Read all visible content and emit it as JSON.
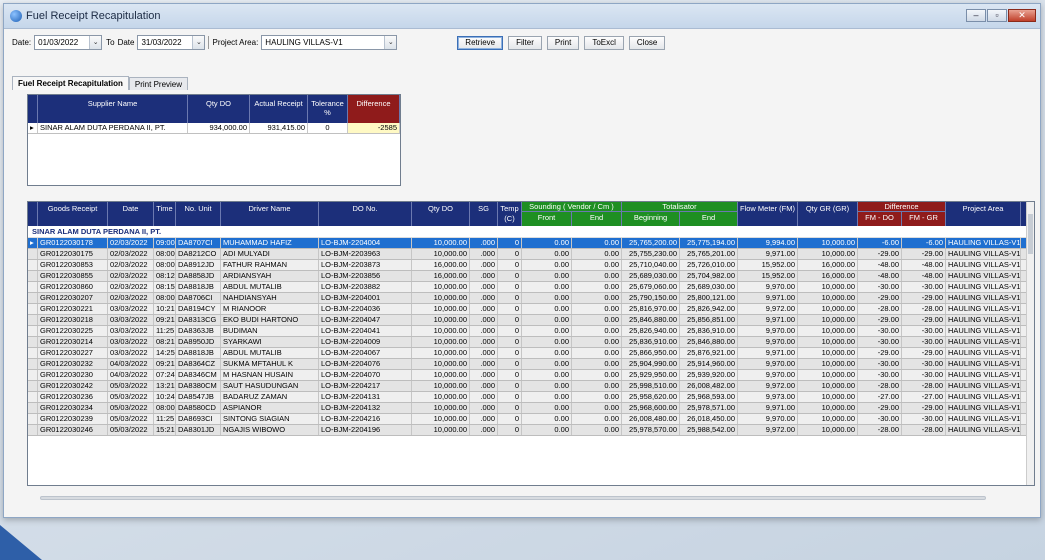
{
  "window": {
    "title": "Fuel Receipt Recapitulation"
  },
  "toolbar": {
    "date_label": "Date:",
    "date_from": "01/03/2022",
    "to_label": "To",
    "date_label2": "Date",
    "date_to": "31/03/2022",
    "project_label": "Project Area:",
    "project_value": "HAULING VILLAS-V1",
    "buttons": [
      "Retrieve",
      "Filter",
      "Print",
      "ToExcl",
      "Close"
    ]
  },
  "tabs": [
    "Fuel Receipt Recapitulation",
    "Print Preview"
  ],
  "summary": {
    "headers": [
      "Supplier Name",
      "Qty DO",
      "Actual Receipt",
      "Tolerance %",
      "Difference"
    ],
    "rows": [
      [
        "SINAR ALAM DUTA PERDANA II, PT.",
        "934,000.00",
        "931,415.00",
        "0",
        "-2585"
      ]
    ]
  },
  "detail": {
    "headers": {
      "goods_receipt": "Goods Receipt",
      "date": "Date",
      "time": "Time",
      "no_unit": "No. Unit",
      "driver": "Driver Name",
      "do_no": "DO No.",
      "qty_do": "Qty DO",
      "sg": "SG",
      "temp": "Temp (C)",
      "sounding": "Sounding ( Vendor / Cm )",
      "sounding_front": "Front",
      "sounding_end": "End",
      "totalisator": "Totalisator",
      "tot_begin": "Beginning",
      "tot_end": "End",
      "flow_meter": "Flow Meter (FM)",
      "qty_gr": "Qty GR (GR)",
      "difference": "Difference",
      "fm_do": "FM - DO",
      "fm_gr": "FM - GR",
      "project_area": "Project Area"
    },
    "group": "SINAR ALAM DUTA PERDANA II, PT.",
    "rows": [
      [
        "GR0122030178",
        "02/03/2022",
        "09:00",
        "DA8707CI",
        "MUHAMMAD HAFIZ",
        "LO-BJM-2204004",
        "10,000.00",
        ".000",
        "0",
        "0.00",
        "0.00",
        "25,765,200.00",
        "25,775,194.00",
        "9,994.00",
        "10,000.00",
        "-6.00",
        "-6.00",
        "HAULING VILLAS-V1"
      ],
      [
        "GR0122030175",
        "02/03/2022",
        "08:00",
        "DA8212CO",
        "ADI MULYADI",
        "LO-BJM-2203963",
        "10,000.00",
        ".000",
        "0",
        "0.00",
        "0.00",
        "25,755,230.00",
        "25,765,201.00",
        "9,971.00",
        "10,000.00",
        "-29.00",
        "-29.00",
        "HAULING VILLAS-V1"
      ],
      [
        "GR0122030853",
        "02/03/2022",
        "08:00",
        "DA8912JD",
        "FATHUR RAHMAN",
        "LO-BJM-2203873",
        "16,000.00",
        ".000",
        "0",
        "0.00",
        "0.00",
        "25,710,040.00",
        "25,726,010.00",
        "15,952.00",
        "16,000.00",
        "-48.00",
        "-48.00",
        "HAULING VILLAS-V1"
      ],
      [
        "GR0122030855",
        "02/03/2022",
        "08:12",
        "DA8858JD",
        "ARDIANSYAH",
        "LO-BJM-2203856",
        "16,000.00",
        ".000",
        "0",
        "0.00",
        "0.00",
        "25,689,030.00",
        "25,704,982.00",
        "15,952.00",
        "16,000.00",
        "-48.00",
        "-48.00",
        "HAULING VILLAS-V1"
      ],
      [
        "GR0122030860",
        "02/03/2022",
        "08:15",
        "DA8818JB",
        "ABDUL MUTALIB",
        "LO-BJM-2203882",
        "10,000.00",
        ".000",
        "0",
        "0.00",
        "0.00",
        "25,679,060.00",
        "25,689,030.00",
        "9,970.00",
        "10,000.00",
        "-30.00",
        "-30.00",
        "HAULING VILLAS-V1"
      ],
      [
        "GR0122030207",
        "02/03/2022",
        "08:00",
        "DA8706CI",
        "NAHDIANSYAH",
        "LO-BJM-2204001",
        "10,000.00",
        ".000",
        "0",
        "0.00",
        "0.00",
        "25,790,150.00",
        "25,800,121.00",
        "9,971.00",
        "10,000.00",
        "-29.00",
        "-29.00",
        "HAULING VILLAS-V1"
      ],
      [
        "GR0122030221",
        "03/03/2022",
        "10:21",
        "DA8194CY",
        "M RIANOOR",
        "LO-BJM-2204036",
        "10,000.00",
        ".000",
        "0",
        "0.00",
        "0.00",
        "25,816,970.00",
        "25,826,942.00",
        "9,972.00",
        "10,000.00",
        "-28.00",
        "-28.00",
        "HAULING VILLAS-V1"
      ],
      [
        "GR0122030218",
        "03/03/2022",
        "09:21",
        "DA8313CG",
        "EKO BUDI HARTONO",
        "LO-BJM-2204047",
        "10,000.00",
        ".000",
        "0",
        "0.00",
        "0.00",
        "25,846,880.00",
        "25,856,851.00",
        "9,971.00",
        "10,000.00",
        "-29.00",
        "-29.00",
        "HAULING VILLAS-V1"
      ],
      [
        "GR0122030225",
        "03/03/2022",
        "11:25",
        "DA8363JB",
        "BUDIMAN",
        "LO-BJM-2204041",
        "10,000.00",
        ".000",
        "0",
        "0.00",
        "0.00",
        "25,826,940.00",
        "25,836,910.00",
        "9,970.00",
        "10,000.00",
        "-30.00",
        "-30.00",
        "HAULING VILLAS-V1"
      ],
      [
        "GR0122030214",
        "03/03/2022",
        "08:21",
        "DA8950JD",
        "SYARKAWI",
        "LO-BJM-2204009",
        "10,000.00",
        ".000",
        "0",
        "0.00",
        "0.00",
        "25,836,910.00",
        "25,846,880.00",
        "9,970.00",
        "10,000.00",
        "-30.00",
        "-30.00",
        "HAULING VILLAS-V1"
      ],
      [
        "GR0122030227",
        "03/03/2022",
        "14:25",
        "DA8818JB",
        "ABDUL MUTALIB",
        "LO-BJM-2204067",
        "10,000.00",
        ".000",
        "0",
        "0.00",
        "0.00",
        "25,866,950.00",
        "25,876,921.00",
        "9,971.00",
        "10,000.00",
        "-29.00",
        "-29.00",
        "HAULING VILLAS-V1"
      ],
      [
        "GR0122030232",
        "04/03/2022",
        "09:21",
        "DA8364CZ",
        "SUKMA MFTAHUL K",
        "LO-BJM-2204076",
        "10,000.00",
        ".000",
        "0",
        "0.00",
        "0.00",
        "25,904,990.00",
        "25,914,960.00",
        "9,970.00",
        "10,000.00",
        "-30.00",
        "-30.00",
        "HAULING VILLAS-V1"
      ],
      [
        "GR0122030230",
        "04/03/2022",
        "07:24",
        "DA8346CM",
        "M HASNAN HUSAIN",
        "LO-BJM-2204070",
        "10,000.00",
        ".000",
        "0",
        "0.00",
        "0.00",
        "25,929,950.00",
        "25,939,920.00",
        "9,970.00",
        "10,000.00",
        "-30.00",
        "-30.00",
        "HAULING VILLAS-V1"
      ],
      [
        "GR0122030242",
        "05/03/2022",
        "13:21",
        "DA8380CM",
        "SAUT HASUDUNGAN",
        "LO-BJM-2204217",
        "10,000.00",
        ".000",
        "0",
        "0.00",
        "0.00",
        "25,998,510.00",
        "26,008,482.00",
        "9,972.00",
        "10,000.00",
        "-28.00",
        "-28.00",
        "HAULING VILLAS-V1"
      ],
      [
        "GR0122030236",
        "05/03/2022",
        "10:24",
        "DA8547JB",
        "BADARUZ ZAMAN",
        "LO-BJM-2204131",
        "10,000.00",
        ".000",
        "0",
        "0.00",
        "0.00",
        "25,958,620.00",
        "25,968,593.00",
        "9,973.00",
        "10,000.00",
        "-27.00",
        "-27.00",
        "HAULING VILLAS-V1"
      ],
      [
        "GR0122030234",
        "05/03/2022",
        "08:00",
        "DA8580CD",
        "ASPIANOR",
        "LO-BJM-2204132",
        "10,000.00",
        ".000",
        "0",
        "0.00",
        "0.00",
        "25,968,600.00",
        "25,978,571.00",
        "9,971.00",
        "10,000.00",
        "-29.00",
        "-29.00",
        "HAULING VILLAS-V1"
      ],
      [
        "GR0122030239",
        "05/03/2022",
        "11:25",
        "DA8693CI",
        "SINTONG SIAGIAN",
        "LO-BJM-2204216",
        "10,000.00",
        ".000",
        "0",
        "0.00",
        "0.00",
        "26,008,480.00",
        "26,018,450.00",
        "9,970.00",
        "10,000.00",
        "-30.00",
        "-30.00",
        "HAULING VILLAS-V1"
      ],
      [
        "GR0122030246",
        "05/03/2022",
        "15:21",
        "DA8301JD",
        "NGAJIS WIBOWO",
        "LO-BJM-2204196",
        "10,000.00",
        ".000",
        "0",
        "0.00",
        "0.00",
        "25,978,570.00",
        "25,988,542.00",
        "9,972.00",
        "10,000.00",
        "-28.00",
        "-28.00",
        "HAULING VILLAS-V1"
      ]
    ]
  }
}
